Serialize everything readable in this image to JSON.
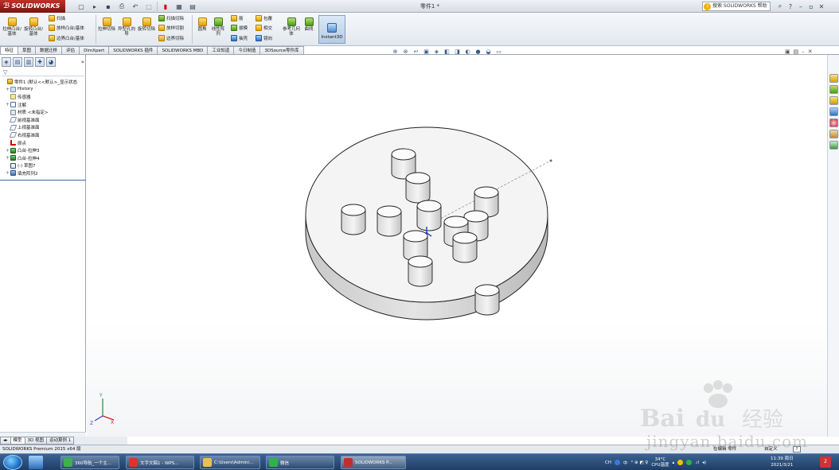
{
  "app": {
    "brand": "SOLIDWORKS",
    "document_title": "零件1 *",
    "search_placeholder": "搜索 SOLIDWORKS 帮助"
  },
  "commands": {
    "extrude_boss": "拉伸凸台/基体",
    "revolve_boss": "旋转凸台/基体",
    "sweep": "扫描",
    "loft": "放样凸台/基体",
    "boundary_boss": "边界凸台/基体",
    "extrude_cut": "拉伸切除",
    "hole_wizard": "异型孔向导",
    "revolve_cut": "旋转切除",
    "sweep_cut": "扫描切除",
    "loft_cut": "放样切割",
    "boundary_cut": "边界切除",
    "fillet": "圆角",
    "linear_pattern": "线性阵列",
    "rib": "筋",
    "draft": "拔模",
    "shell": "抽壳",
    "wrap": "包覆",
    "intersect": "相交",
    "mirror": "镜向",
    "reference_geometry": "参考几何体",
    "curves": "曲线",
    "instant3d": "Instant3D"
  },
  "tabs": [
    "特征",
    "草图",
    "数据迁移",
    "评估",
    "DimXpert",
    "SOLIDWORKS 插件",
    "SOLIDWORKS MBD",
    "工业知道",
    "今日制造",
    "3DSource零件库"
  ],
  "tree": [
    {
      "label": "零件1 (默认<<默认>_显示状态",
      "icon": "part-icon",
      "indent": 0,
      "expander": ""
    },
    {
      "label": "History",
      "icon": "history-icon",
      "indent": 1,
      "expander": "+"
    },
    {
      "label": "传感器",
      "icon": "sensor-icon",
      "indent": 1,
      "expander": ""
    },
    {
      "label": "注解",
      "icon": "annotation-icon",
      "indent": 1,
      "expander": "+"
    },
    {
      "label": "材质 <未指定>",
      "icon": "material-icon",
      "indent": 1,
      "expander": ""
    },
    {
      "label": "前视基准面",
      "icon": "plane-icon",
      "indent": 1,
      "expander": ""
    },
    {
      "label": "上视基准面",
      "icon": "plane-icon",
      "indent": 1,
      "expander": ""
    },
    {
      "label": "右视基准面",
      "icon": "plane-icon",
      "indent": 1,
      "expander": ""
    },
    {
      "label": "原点",
      "icon": "origin-icon",
      "indent": 1,
      "expander": ""
    },
    {
      "label": "凸台-拉伸3",
      "icon": "extrude-feature-icon",
      "indent": 1,
      "expander": "+"
    },
    {
      "label": "凸台-拉伸4",
      "icon": "extrude-feature-icon",
      "indent": 1,
      "expander": "+"
    },
    {
      "label": "(-) 草图7",
      "icon": "sketch-icon",
      "indent": 1,
      "expander": ""
    },
    {
      "label": "填充阵列2",
      "icon": "fill-pattern-icon",
      "indent": 1,
      "expander": "+"
    }
  ],
  "bottom_tabs": [
    "模型",
    "3D 视图",
    "运动算例 1"
  ],
  "statusbar": {
    "left": "SOLIDWORKS Premium 2015 x64 版",
    "mode": "在编辑 零件",
    "custom": "自定义"
  },
  "taskbar": {
    "apps": [
      {
        "label": "360导航_一个主...",
        "color": "#3bb34a"
      },
      {
        "label": "文字文稿1 - WPS...",
        "color": "#d9352a"
      },
      {
        "label": "C:\\Users\\Admini...",
        "color": "#e8c24a"
      },
      {
        "label": "微信",
        "color": "#2db34a"
      },
      {
        "label": "SOLIDWORKS P...",
        "color": "#c0302a"
      }
    ],
    "ime": "CH",
    "ime_lang": "中",
    "temperature": "34°C",
    "cpu_label": "CPU温度",
    "time": "11:39 周日",
    "date": "2021/3/21"
  },
  "watermark": {
    "text": "jingyan.baidu.com"
  },
  "colors": {
    "accent": "#c0302a",
    "selection": "#3a6bb4",
    "part_face": "#f4f4f4",
    "part_side": "#d4d4d4"
  },
  "scene": {
    "pins": 12
  }
}
